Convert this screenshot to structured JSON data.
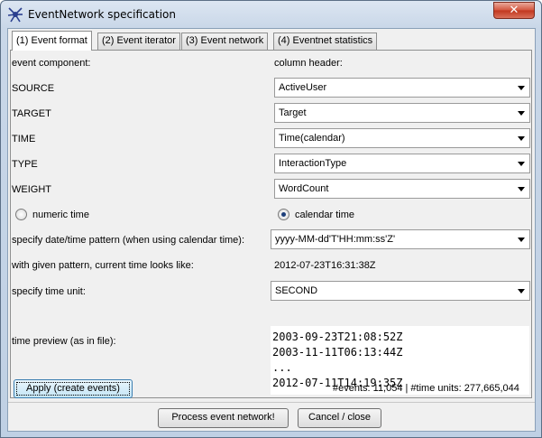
{
  "window": {
    "title": "EventNetwork specification",
    "close_label": "✕"
  },
  "tabs": [
    {
      "label": "(1) Event format",
      "active": true
    },
    {
      "label": "(2) Event iterator",
      "active": false
    },
    {
      "label": "(3) Event network",
      "active": false
    },
    {
      "label": "(4) Eventnet statistics",
      "active": false
    }
  ],
  "form": {
    "event_component_label": "event component:",
    "column_header_label": "column header:",
    "rows": [
      {
        "label": "SOURCE",
        "value": "ActiveUser"
      },
      {
        "label": "TARGET",
        "value": "Target"
      },
      {
        "label": "TIME",
        "value": "Time(calendar)"
      },
      {
        "label": "TYPE",
        "value": "InteractionType"
      },
      {
        "label": "WEIGHT",
        "value": "WordCount"
      }
    ],
    "numeric_time_label": "numeric time",
    "calendar_time_label": "calendar time",
    "calendar_time_selected": true,
    "pattern_label": "specify date/time pattern (when using calendar time):",
    "pattern_value": "yyyy-MM-dd'T'HH:mm:ss'Z'",
    "current_time_label": "with given pattern, current time looks like:",
    "current_time_value": "2012-07-23T16:31:38Z",
    "time_unit_label": "specify time unit:",
    "time_unit_value": "SECOND",
    "preview_label": "time preview (as in file):",
    "preview_lines": [
      "2003-09-23T21:08:52Z",
      "2003-11-11T06:13:44Z",
      "...",
      "2012-07-11T14:19:35Z"
    ],
    "apply_label": "Apply (create events)",
    "status_text": "#events: 11,054 | #time units: 277,665,044"
  },
  "footer": {
    "process_label": "Process event network!",
    "cancel_label": "Cancel / close"
  }
}
